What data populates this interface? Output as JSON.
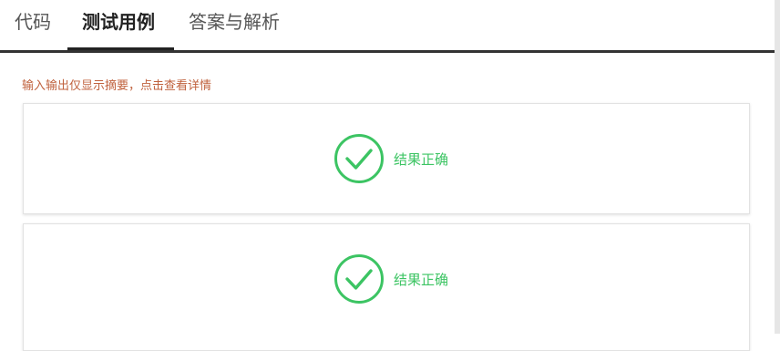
{
  "tabs": [
    {
      "label": "代码"
    },
    {
      "label": "测试用例"
    },
    {
      "label": "答案与解析"
    }
  ],
  "active_tab": "测试用例",
  "notice": "输入输出仅显示摘要，点击查看详情",
  "cases": [
    {
      "status": "结果正确",
      "icon": "check-circle-icon"
    },
    {
      "status": "结果正确",
      "icon": "check-circle-icon"
    }
  ],
  "colors": {
    "accent_success": "#3cc463",
    "notice_text": "#c0623e",
    "tab_active": "#222222"
  }
}
